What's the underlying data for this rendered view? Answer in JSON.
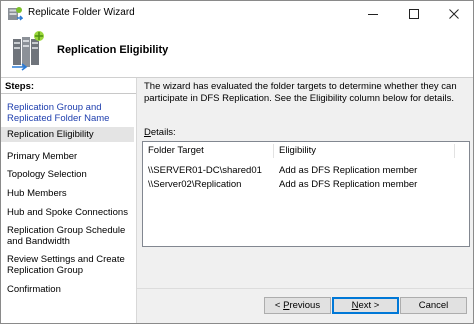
{
  "window": {
    "title": "Replicate Folder Wizard",
    "controls": {
      "minimize_icon": "minimize-icon",
      "maximize_icon": "maximize-icon",
      "close_icon": "close-icon"
    }
  },
  "header": {
    "title": "Replication Eligibility",
    "icon": "replication-wizard-icon"
  },
  "steps": {
    "heading": "Steps:",
    "items": [
      {
        "label": "Replication Group and Replicated Folder Name",
        "state": "completed-link"
      },
      {
        "label": "Replication Eligibility",
        "state": "current"
      },
      {
        "label": "Primary Member",
        "state": "pending"
      },
      {
        "label": "Topology Selection",
        "state": "pending"
      },
      {
        "label": "Hub Members",
        "state": "pending"
      },
      {
        "label": "Hub and Spoke Connections",
        "state": "pending"
      },
      {
        "label": "Replication Group Schedule and Bandwidth",
        "state": "pending"
      },
      {
        "label": "Review Settings and Create Replication Group",
        "state": "pending"
      },
      {
        "label": "Confirmation",
        "state": "pending"
      }
    ]
  },
  "main": {
    "intro": "The wizard has evaluated the folder targets to determine whether they can participate in DFS Replication. See the Eligibility column below for details.",
    "details_label_first": "D",
    "details_label_rest": "etails:",
    "table": {
      "columns": [
        "Folder Target",
        "Eligibility"
      ],
      "rows": [
        {
          "target": "\\\\SERVER01-DC\\shared01",
          "eligibility": "Add as DFS Replication member"
        },
        {
          "target": "\\\\Server02\\Replication",
          "eligibility": "Add as DFS Replication member"
        }
      ]
    }
  },
  "buttons": {
    "previous_prefix": "< ",
    "previous_key": "P",
    "previous_rest": "revious",
    "next_key": "N",
    "next_rest": "ext >",
    "cancel": "Cancel"
  },
  "colors": {
    "link": "#1f3fae",
    "current_step_bg": "#e4e4e4",
    "default_button_border": "#0078d7"
  }
}
